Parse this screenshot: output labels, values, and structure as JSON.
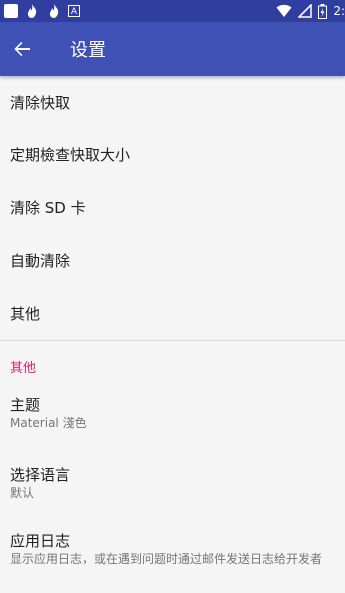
{
  "colors": {
    "status_bar": "#303f9f",
    "app_bar": "#3f51b5",
    "accent": "#e91e63",
    "background": "#f5f5f5"
  },
  "status_bar": {
    "left_icons": [
      "app-notification-icon",
      "fire-icon",
      "fire-icon",
      "a-icon"
    ],
    "time": "2:"
  },
  "app_bar": {
    "back_icon": "arrow-back-icon",
    "title": "设置"
  },
  "preferences": [
    "清除快取",
    "定期檢查快取大小",
    "清除 SD 卡",
    "自動清除",
    "其他"
  ],
  "category": "其他",
  "theme": {
    "title": "主题",
    "summary": "Material 淺色"
  },
  "language": {
    "title": "选择语言",
    "summary": "默认"
  },
  "log": {
    "title": "应用日志",
    "summary": "显示应用日志，或在遇到问题时通过邮件发送日志给开发者"
  }
}
